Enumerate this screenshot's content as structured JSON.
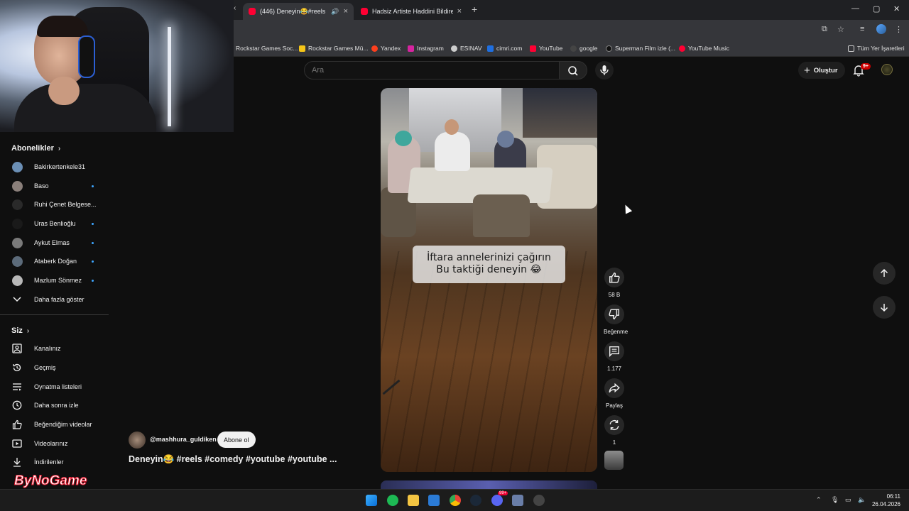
{
  "browser": {
    "tabs": [
      {
        "title": "(446) Deneyin😂#reels #co",
        "active": true
      },
      {
        "title": "Hadsiz Artiste Haddini Bildiren",
        "active": false
      }
    ],
    "bookmarks": [
      {
        "label": "Rockstar Games Soc...",
        "color": "#35363a"
      },
      {
        "label": "Rockstar Games Mü...",
        "color": "#f5c518"
      },
      {
        "label": "Yandex",
        "color": "#fc3f1d"
      },
      {
        "label": "Instagram",
        "color": "#d6249f"
      },
      {
        "label": "ESINAV",
        "color": "#cccccc"
      },
      {
        "label": "cimri.com",
        "color": "#1f6fe0"
      },
      {
        "label": "YouTube",
        "color": "#ff0033"
      },
      {
        "label": "google",
        "color": "#444444"
      },
      {
        "label": "Superman Film izle (...",
        "color": "#222222"
      },
      {
        "label": "YouTube Music",
        "color": "#ff0033"
      }
    ],
    "all_bookmarks": "Tüm Yer İşaretleri"
  },
  "header": {
    "search_placeholder": "Ara",
    "create_label": "Oluştur",
    "notif_badge": "9+"
  },
  "sidebar": {
    "subscriptions_title": "Abonelikler",
    "channels": [
      {
        "name": "Bakirkertenkele31",
        "dot": false,
        "avatar": "#6b8fb5"
      },
      {
        "name": "Baso",
        "dot": true,
        "avatar": "#8a7f7a"
      },
      {
        "name": "Ruhi Çenet Belgese...",
        "dot": false,
        "avatar": "#2a2a2a"
      },
      {
        "name": "Uras Benlioğlu",
        "dot": true,
        "avatar": "#1a1a1a"
      },
      {
        "name": "Aykut Elmas",
        "dot": true,
        "avatar": "#7a7a7a"
      },
      {
        "name": "Ataberk Doğan",
        "dot": true,
        "avatar": "#5c6b7a"
      },
      {
        "name": "Mazlum Sönmez",
        "dot": true,
        "avatar": "#b8b8b8"
      }
    ],
    "show_more": "Daha fazla göster",
    "you_title": "Siz",
    "you_items": [
      {
        "label": "Kanalınız",
        "icon": "channel-icon"
      },
      {
        "label": "Geçmiş",
        "icon": "history-icon"
      },
      {
        "label": "Oynatma listeleri",
        "icon": "playlists-icon"
      },
      {
        "label": "Daha sonra izle",
        "icon": "watch-later-icon"
      },
      {
        "label": "Beğendiğim videolar",
        "icon": "liked-videos-icon"
      },
      {
        "label": "Videolarınız",
        "icon": "your-videos-icon"
      },
      {
        "label": "İndirilenler",
        "icon": "downloads-icon"
      }
    ]
  },
  "video": {
    "caption_line1": "İftara annelerinizi çağırın",
    "caption_line2": "Bu taktiği deneyin 😂",
    "channel": "@mashhura_guldiken",
    "subscribe": "Abone ol",
    "title": "Deneyin😂 #reels #comedy #youtube #youtube ..."
  },
  "actions": {
    "likes": "58 B",
    "dislike": "Beğenme",
    "comments": "1.177",
    "share": "Paylaş",
    "remix": "1"
  },
  "watermark": "ByNoGame",
  "taskbar": {
    "time": "06:11",
    "date": "26.04.2026",
    "discord_badge": "99+"
  }
}
